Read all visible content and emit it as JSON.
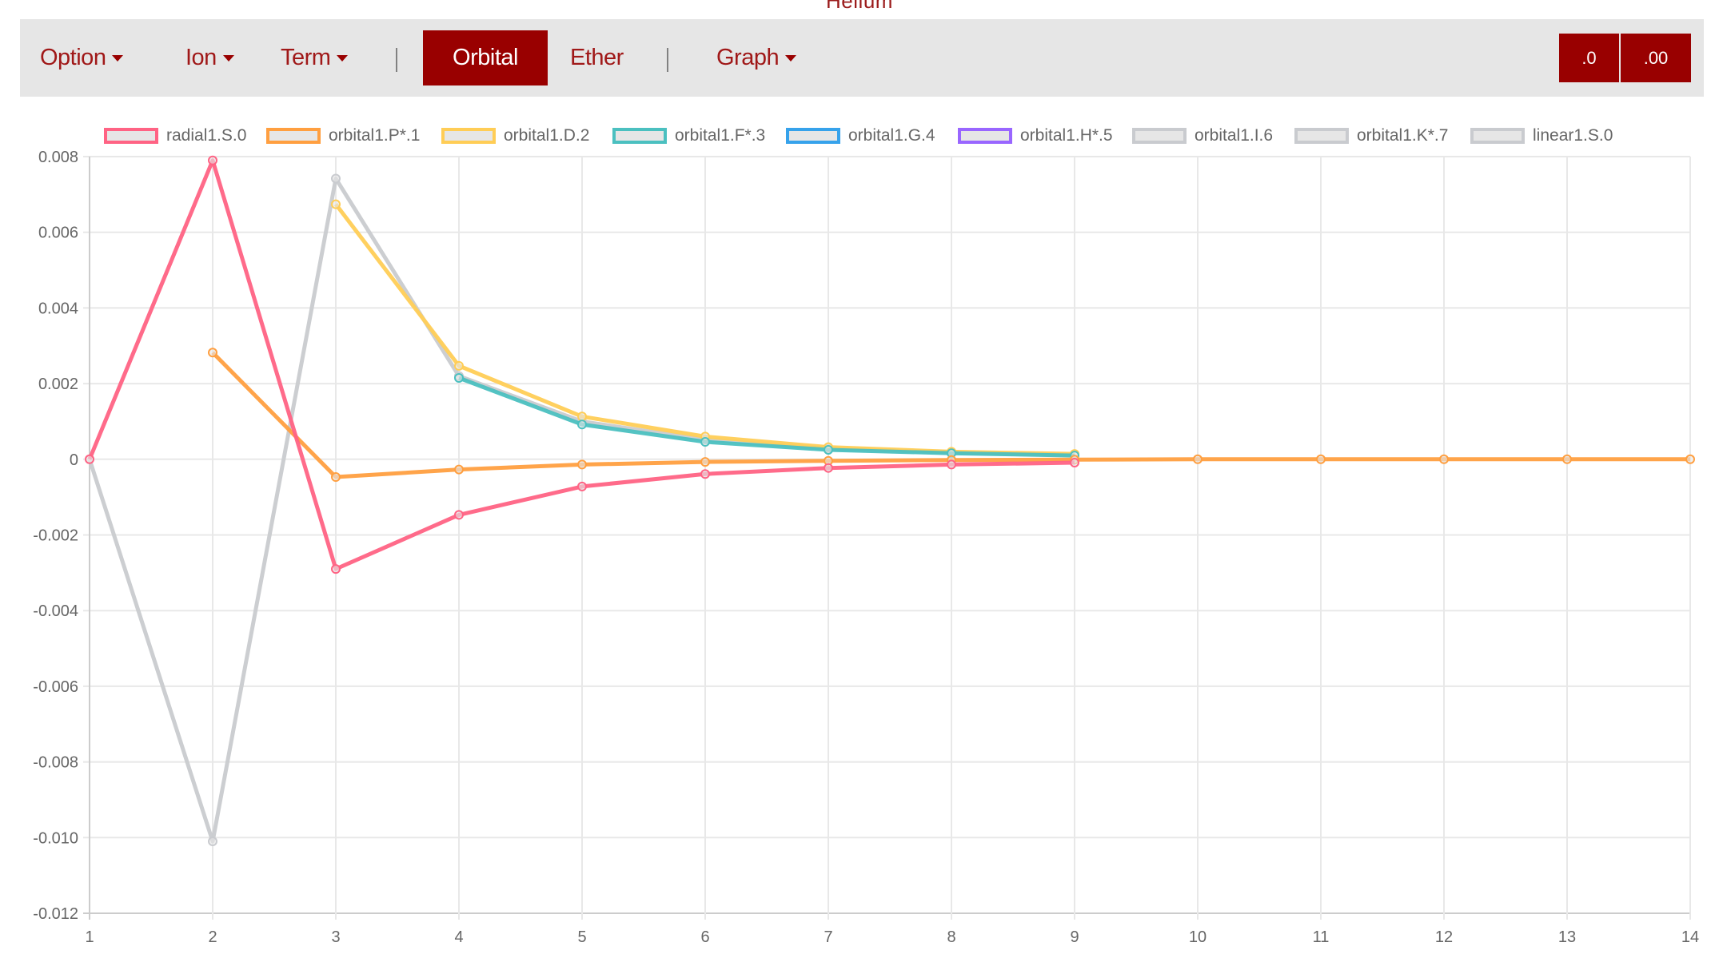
{
  "page": {
    "title": "Helium"
  },
  "navbar": {
    "items": [
      {
        "label": "Option",
        "dropdown": true
      },
      {
        "label": "Ion",
        "dropdown": true
      },
      {
        "label": "Term",
        "dropdown": true
      },
      {
        "label": "Orbital",
        "active": true
      },
      {
        "label": "Ether"
      },
      {
        "label": "Graph",
        "dropdown": true
      }
    ],
    "separator": "|",
    "precision_buttons": [
      ".0",
      ".00"
    ]
  },
  "colors": {
    "accent": "#990000",
    "navbar_bg": "#e6e6e6",
    "nav_text": "#a01818"
  },
  "chart_data": {
    "type": "line",
    "title": "",
    "xlabel": "",
    "ylabel": "",
    "x": [
      1,
      2,
      3,
      4,
      5,
      6,
      7,
      8,
      9,
      10,
      11,
      12,
      13,
      14
    ],
    "xlim": [
      1,
      14
    ],
    "ylim": [
      -0.012,
      0.008
    ],
    "yticks": [
      0.008,
      0.006,
      0.004,
      0.002,
      0,
      -0.002,
      -0.004,
      -0.006,
      -0.008,
      -0.01,
      -0.012
    ],
    "ytick_labels": [
      "0.008",
      "0.006",
      "0.004",
      "0.002",
      "0",
      "-0.002",
      "-0.004",
      "-0.006",
      "-0.008",
      "-0.010",
      "-0.012"
    ],
    "xtick_labels": [
      "1",
      "2",
      "3",
      "4",
      "5",
      "6",
      "7",
      "8",
      "9",
      "10",
      "11",
      "12",
      "13",
      "14"
    ],
    "grid": true,
    "legend_position": "top",
    "series": [
      {
        "name": "radial1.S.0",
        "color": "#ff6384",
        "hidden": false,
        "values": [
          0,
          0.0079,
          -0.0029,
          -0.00147,
          -0.00072,
          -0.00039,
          -0.00023,
          -0.00014,
          -9e-05,
          null,
          null,
          null,
          null,
          null
        ]
      },
      {
        "name": "orbital1.P*.1",
        "color": "#ff9f40",
        "hidden": false,
        "values": [
          null,
          0.00282,
          -0.00047,
          -0.00027,
          -0.00014,
          -7e-05,
          -4e-05,
          -2e-05,
          -1e-05,
          0,
          0,
          0,
          0,
          0
        ]
      },
      {
        "name": "orbital1.D.2",
        "color": "#ffcd56",
        "hidden": false,
        "values": [
          null,
          null,
          0.00674,
          0.00247,
          0.00113,
          0.0006,
          0.00032,
          0.0002,
          0.00014,
          null,
          null,
          null,
          null,
          null
        ]
      },
      {
        "name": "orbital1.F*.3",
        "color": "#4bc0c0",
        "hidden": false,
        "values": [
          null,
          null,
          null,
          0.00215,
          0.00092,
          0.00046,
          0.00025,
          0.00016,
          0.0001,
          null,
          null,
          null,
          null,
          null
        ]
      },
      {
        "name": "orbital1.G.4",
        "color": "#36a2eb",
        "hidden": false,
        "values": []
      },
      {
        "name": "orbital1.H*.5",
        "color": "#9966ff",
        "hidden": false,
        "values": []
      },
      {
        "name": "orbital1.I.6",
        "color": "#c9cbcf",
        "hidden": false,
        "values": []
      },
      {
        "name": "orbital1.K*.7",
        "color": "#c9cbcf",
        "hidden": false,
        "values": []
      },
      {
        "name": "linear1.S.0",
        "color": "#c9cbcf",
        "hidden": false,
        "values": [
          0,
          -0.0101,
          0.00742,
          0.0022,
          0.001,
          0.00052,
          0.00028,
          0.00018,
          0.00012,
          null,
          null,
          null,
          null,
          null
        ]
      }
    ]
  }
}
